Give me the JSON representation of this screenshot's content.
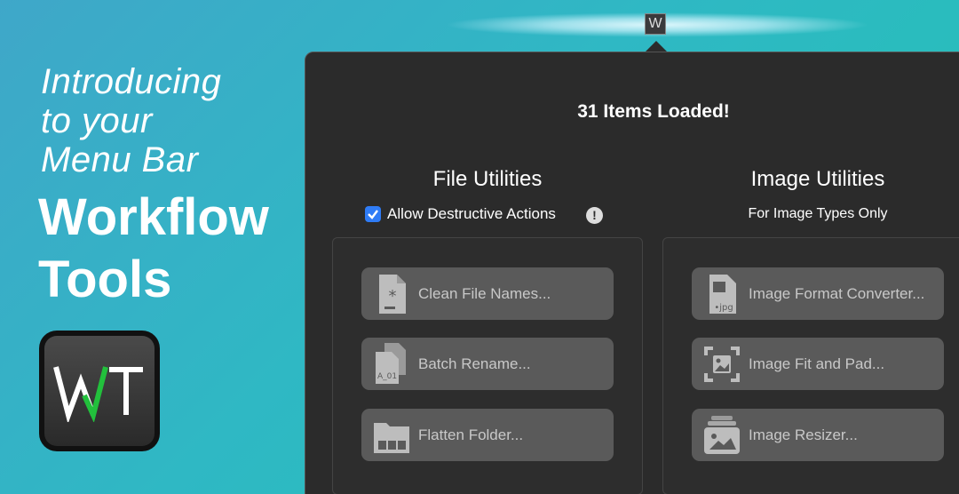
{
  "promo": {
    "intro_lines": [
      "Introducing",
      "to your",
      "Menu Bar"
    ],
    "headline_lines": [
      "Workflow",
      "Tools"
    ],
    "app_icon_letters": "WT",
    "app_icon_check_color": "#22c03c"
  },
  "menubar": {
    "icon_letter": "W"
  },
  "popover": {
    "status": "31 Items Loaded!",
    "file_utilities": {
      "title": "File Utilities",
      "allow_destructive_label": "Allow Destructive Actions",
      "allow_destructive_checked": true,
      "info_icon_text": "!",
      "tools": [
        {
          "label": "Clean File Names...",
          "icon": "asterisk-doc-icon"
        },
        {
          "label": "Batch Rename...",
          "icon": "stacked-docs-icon"
        },
        {
          "label": "Flatten Folder...",
          "icon": "folder-icon"
        }
      ]
    },
    "image_utilities": {
      "title": "Image Utilities",
      "subtitle": "For Image Types Only",
      "tools": [
        {
          "label": "Image Format Converter...",
          "icon": "jpg-doc-icon"
        },
        {
          "label": "Image Fit and Pad...",
          "icon": "image-frame-icon"
        },
        {
          "label": "Image Resizer...",
          "icon": "image-stack-icon"
        }
      ]
    }
  },
  "colors": {
    "accent": "#2f7cf6",
    "popover_bg": "#2b2b2b",
    "button_bg": "#5a5a5a",
    "button_text": "#c8c8c8"
  }
}
